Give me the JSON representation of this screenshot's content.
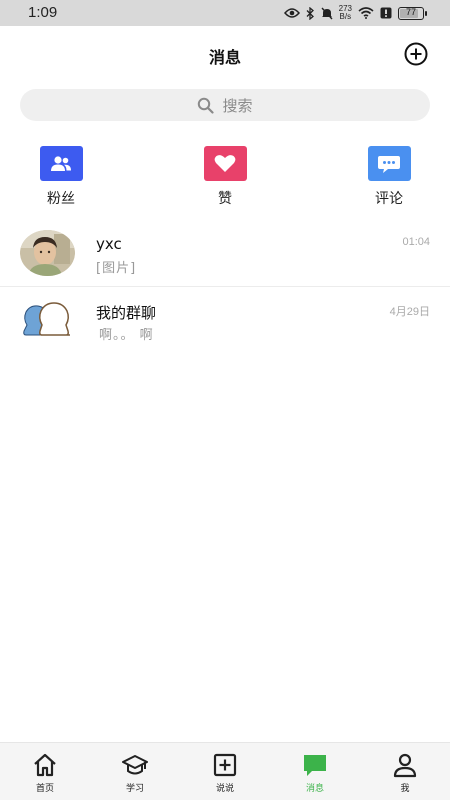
{
  "status_bar": {
    "time": "1:09",
    "net_speed_value": "273",
    "net_speed_unit": "B/s",
    "battery_level": "77"
  },
  "header": {
    "title": "消息",
    "add_icon": "plus-circle-icon"
  },
  "search": {
    "placeholder": "搜索",
    "icon": "search-icon"
  },
  "quick_actions": [
    {
      "label": "粉丝",
      "icon": "people-icon",
      "color": "#3d5bf0"
    },
    {
      "label": "赞",
      "icon": "heart-icon",
      "color": "#e8416a"
    },
    {
      "label": "评论",
      "icon": "chat-bubble-icon",
      "color": "#4a90f0"
    }
  ],
  "conversations": [
    {
      "name": "yxc",
      "preview": "[图片]",
      "time": "01:04",
      "avatar": "user-photo-avatar"
    },
    {
      "name": "我的群聊",
      "preview": "啊。。 啊",
      "time": "4月29日",
      "avatar": "group-avatar-icon"
    }
  ],
  "tabs": [
    {
      "label": "首页",
      "icon": "home-icon",
      "active": false
    },
    {
      "label": "学习",
      "icon": "graduation-cap-icon",
      "active": false
    },
    {
      "label": "说说",
      "icon": "plus-square-icon",
      "active": false
    },
    {
      "label": "消息",
      "icon": "message-icon",
      "active": true
    },
    {
      "label": "我",
      "icon": "person-icon",
      "active": false
    }
  ],
  "colors": {
    "active_tab": "#3cb34a",
    "search_bg": "#efefef",
    "status_bar_bg": "#d9d9d9"
  }
}
